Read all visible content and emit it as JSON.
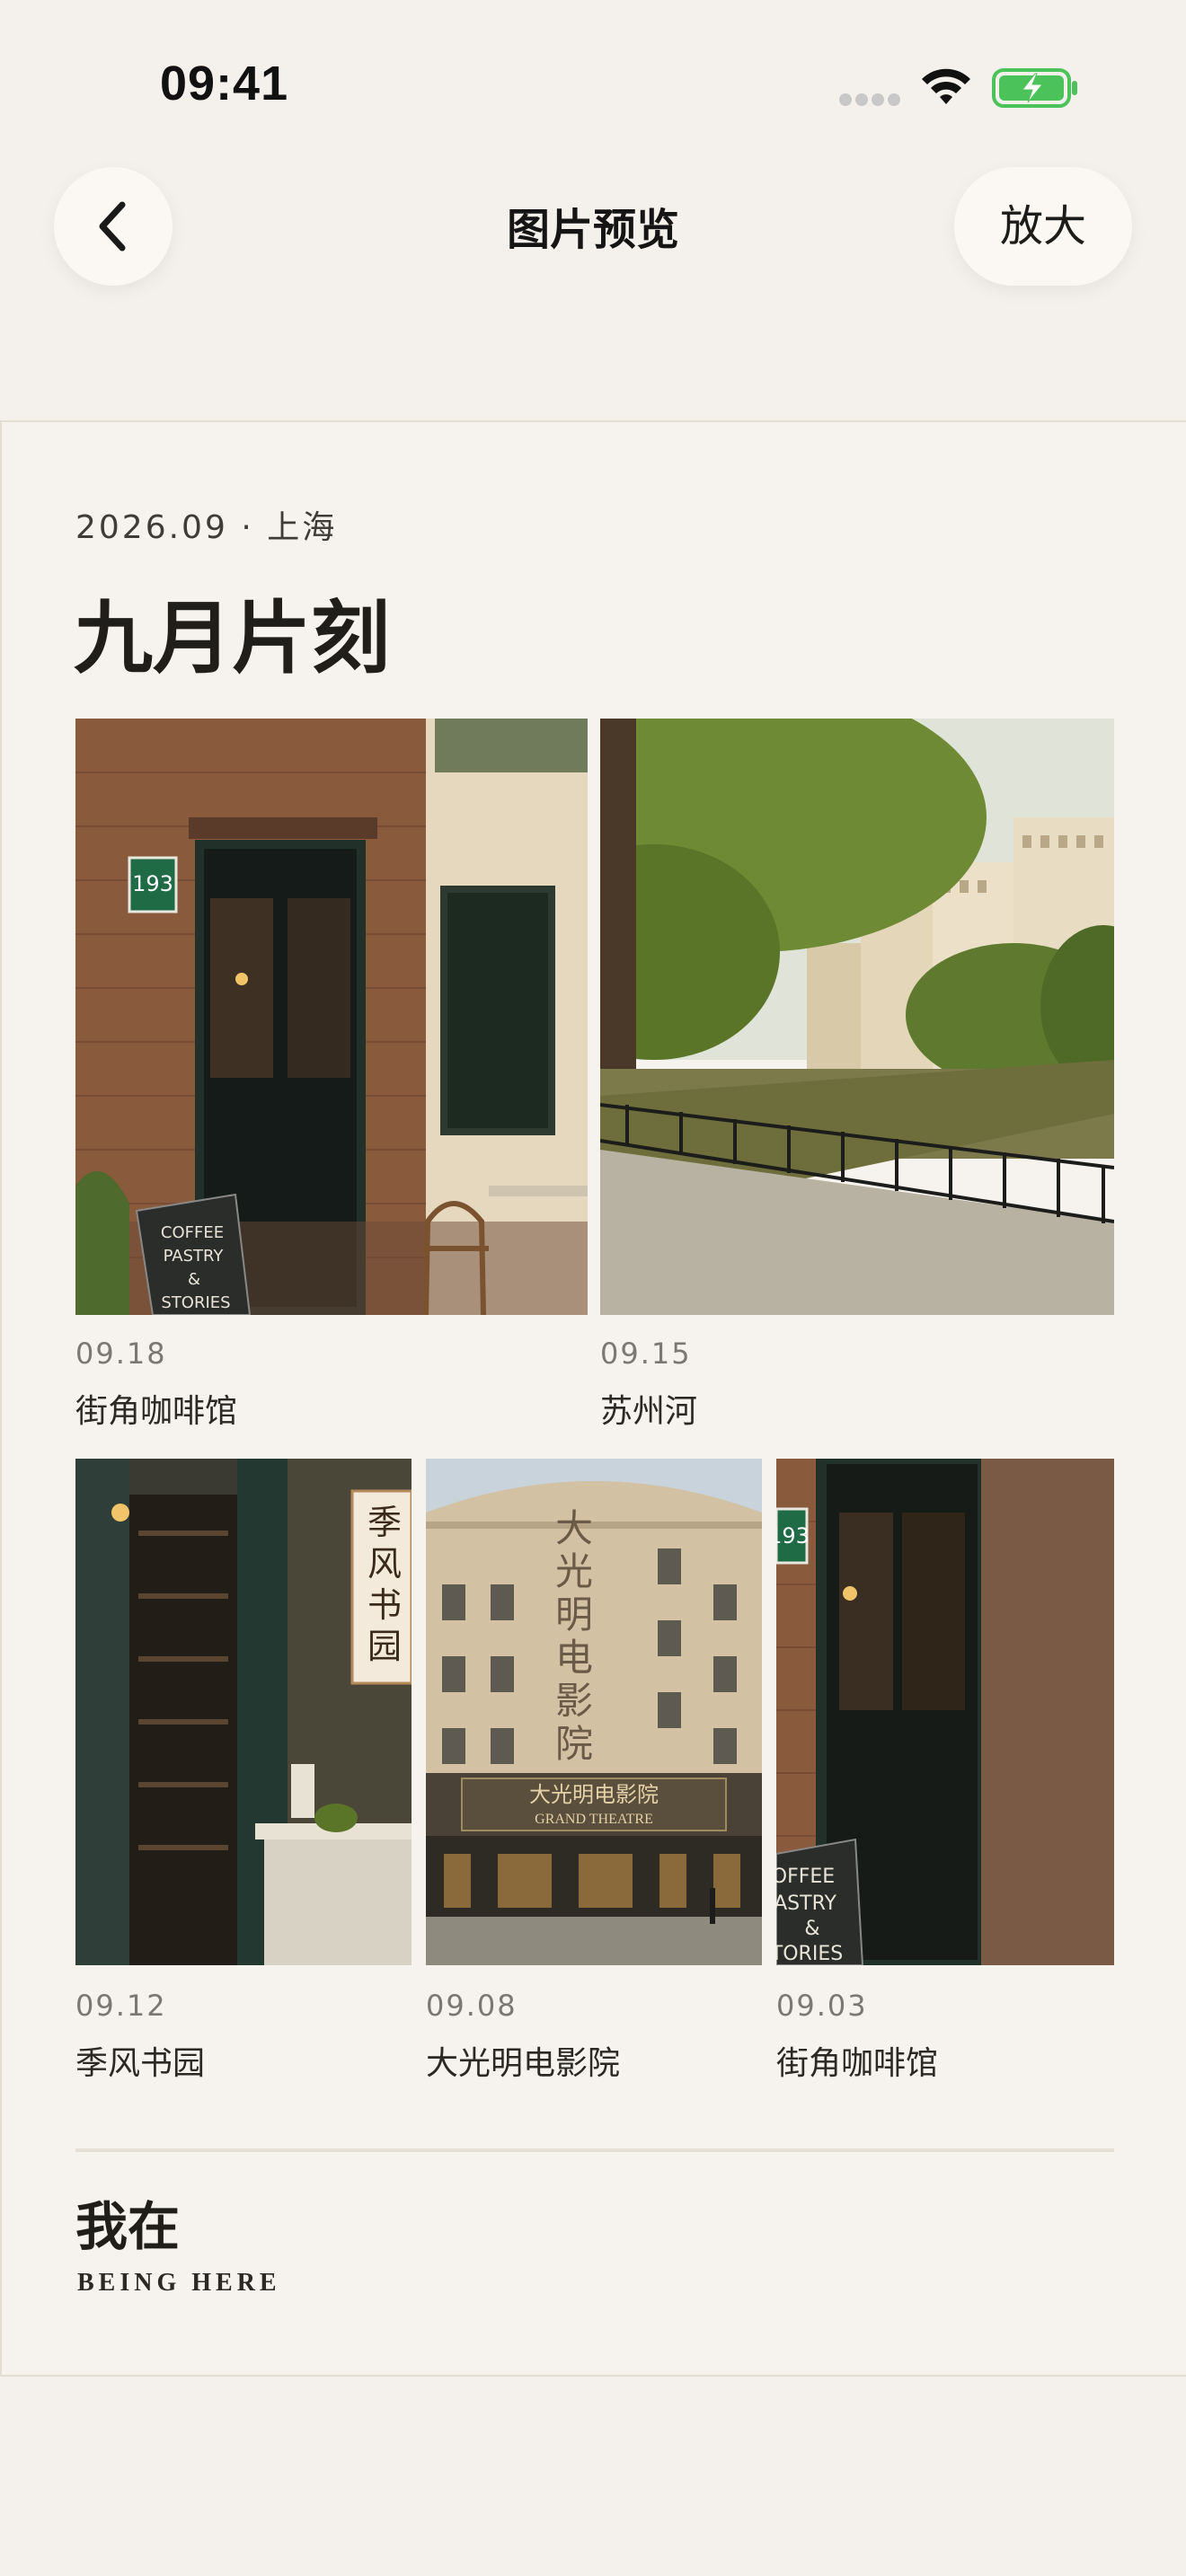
{
  "status_bar": {
    "time": "09:41",
    "icons": [
      "signal-dots-icon",
      "wifi-icon",
      "battery-charging-icon"
    ]
  },
  "nav": {
    "back_icon": "chevron-left-icon",
    "title": "图片预览",
    "zoom_label": "放大"
  },
  "album": {
    "meta": "2026.09 · 上海",
    "title": "九月片刻",
    "photos": [
      {
        "date": "09.18",
        "name": "街角咖啡馆",
        "scene": "cafe-storefront"
      },
      {
        "date": "09.15",
        "name": "苏州河",
        "scene": "riverside-walk"
      },
      {
        "date": "09.12",
        "name": "季风书园",
        "scene": "bookstore-entrance"
      },
      {
        "date": "09.08",
        "name": "大光明电影院",
        "scene": "grand-theatre"
      },
      {
        "date": "09.03",
        "name": "街角咖啡馆",
        "scene": "cafe-doorway"
      }
    ]
  },
  "photo_text": {
    "house_number": "193",
    "cafe_sign": [
      "COFFEE",
      "PASTRY",
      "&",
      "STORIES"
    ],
    "bookstore_sign": [
      "季",
      "风",
      "书",
      "园"
    ],
    "theatre_vertical": [
      "大",
      "光",
      "明",
      "电",
      "影",
      "院"
    ],
    "theatre_marquee": "大光明电影院",
    "theatre_english": "GRAND THEATRE",
    "cafe_sign_cropped": [
      "OFFEE",
      "ASTRY",
      "&",
      "TORIES"
    ]
  },
  "footer": {
    "title": "我在",
    "subtitle": "BEING HERE"
  },
  "colors": {
    "background": "#f4f1ec",
    "card": "#f6f3ee",
    "brick": "#8a5a3c",
    "foliage": "#5f7a2e",
    "battery_green": "#4cc35a"
  }
}
